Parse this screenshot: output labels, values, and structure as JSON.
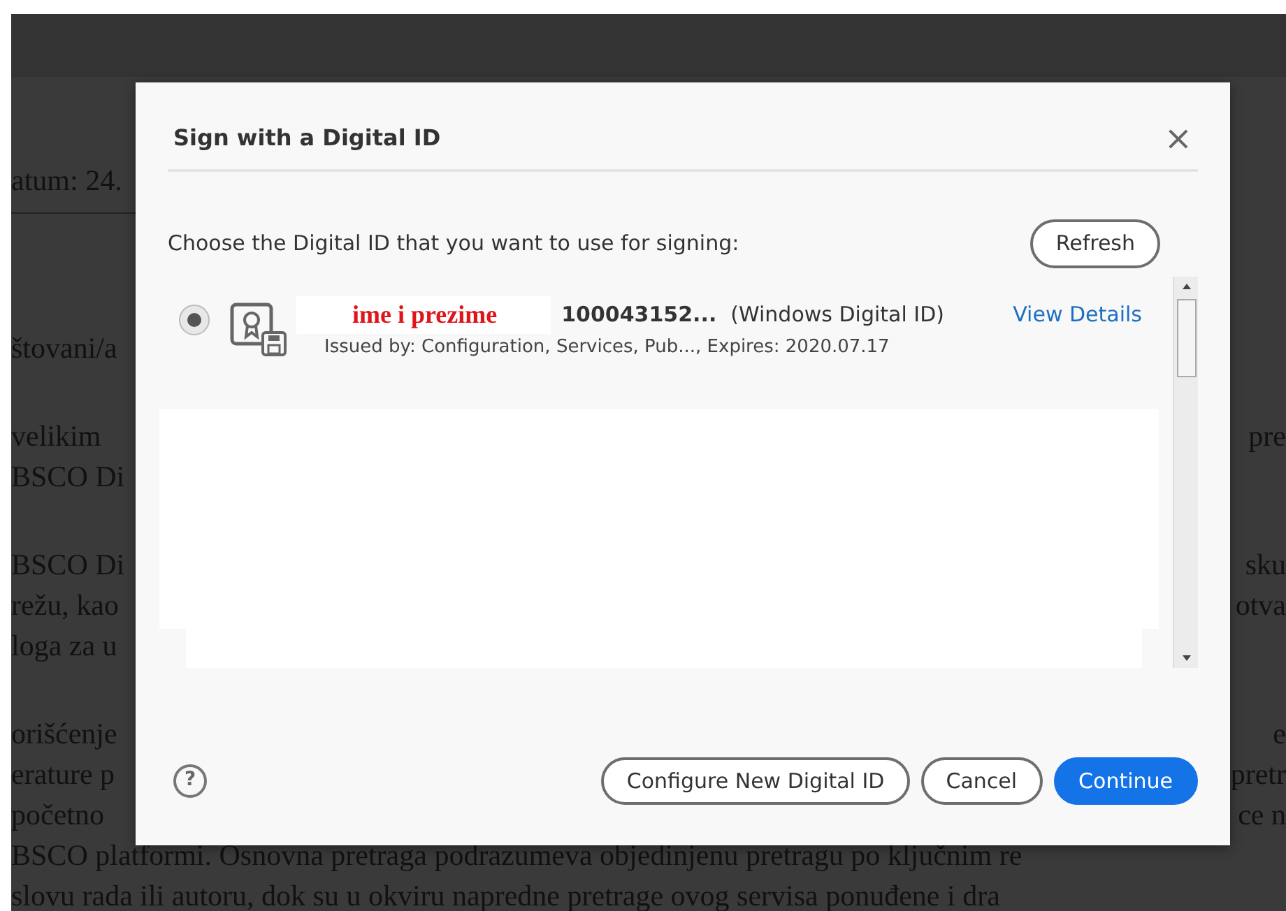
{
  "document": {
    "header": {
      "left": "atum: 24."
    },
    "paragraphs": [
      {
        "lines": [
          {
            "left": "štovani/a"
          }
        ]
      },
      {
        "lines": [
          {
            "left": "velikim",
            "right": "pre"
          },
          {
            "left": "BSCO Di"
          }
        ]
      },
      {
        "lines": [
          {
            "left": "BSCO Di",
            "right": "sku"
          },
          {
            "left": "režu, kao",
            "right": "otva"
          },
          {
            "left": "loga za u"
          }
        ]
      },
      {
        "lines": [
          {
            "left": "orišćenje",
            "right": "e"
          },
          {
            "left": "erature p",
            "right": "pretr"
          },
          {
            "left": "početno",
            "right": "ce n"
          },
          {
            "left": "BSCO platformi. Osnovna pretraga podrazumeva objedinjenu pretragu po ključnim re"
          },
          {
            "left": "slovu rada ili autoru, dok su u okviru napredne pretrage ovog servisa ponuđene i dra"
          }
        ]
      }
    ]
  },
  "dialog": {
    "title": "Sign with a Digital ID",
    "close": "×",
    "prompt": "Choose the Digital ID that you want to use for signing:",
    "refresh": "Refresh",
    "ids": [
      {
        "name": "ime i prezime",
        "serial": "100043152...",
        "type": "(Windows Digital ID)",
        "details": "View Details",
        "issued": "Issued by: Configuration, Services, Pub..., Expires: 2020.07.17",
        "selected": true
      }
    ],
    "help": "?",
    "buttons": [
      {
        "label": "Configure New Digital ID",
        "kind": "secondary"
      },
      {
        "label": "Cancel",
        "kind": "secondary"
      },
      {
        "label": "Continue",
        "kind": "primary"
      }
    ]
  }
}
